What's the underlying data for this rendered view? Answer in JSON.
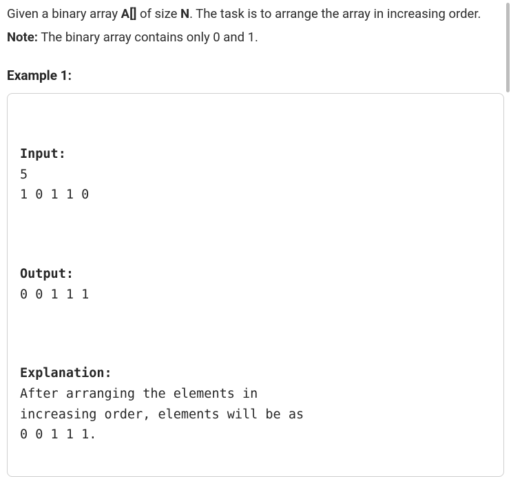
{
  "problem": {
    "p1_prefix": "Given a binary array ",
    "p1_bold1": "A[]",
    "p1_mid1": " of size ",
    "p1_bold2": "N",
    "p1_suffix": ". The task is to arrange the array in increasing order.",
    "note_label": "Note:",
    "note_text": " The binary array contains only 0  and 1."
  },
  "example": {
    "heading": "Example 1:",
    "input_label": "Input:",
    "input_body": "5\n1 0 1 1 0",
    "output_label": "Output:",
    "output_body": "0 0 1 1 1",
    "explanation_label": "Explanation:",
    "explanation_body": "After arranging the elements in\nincreasing order, elements will be as \n0 0 1 1 1."
  }
}
